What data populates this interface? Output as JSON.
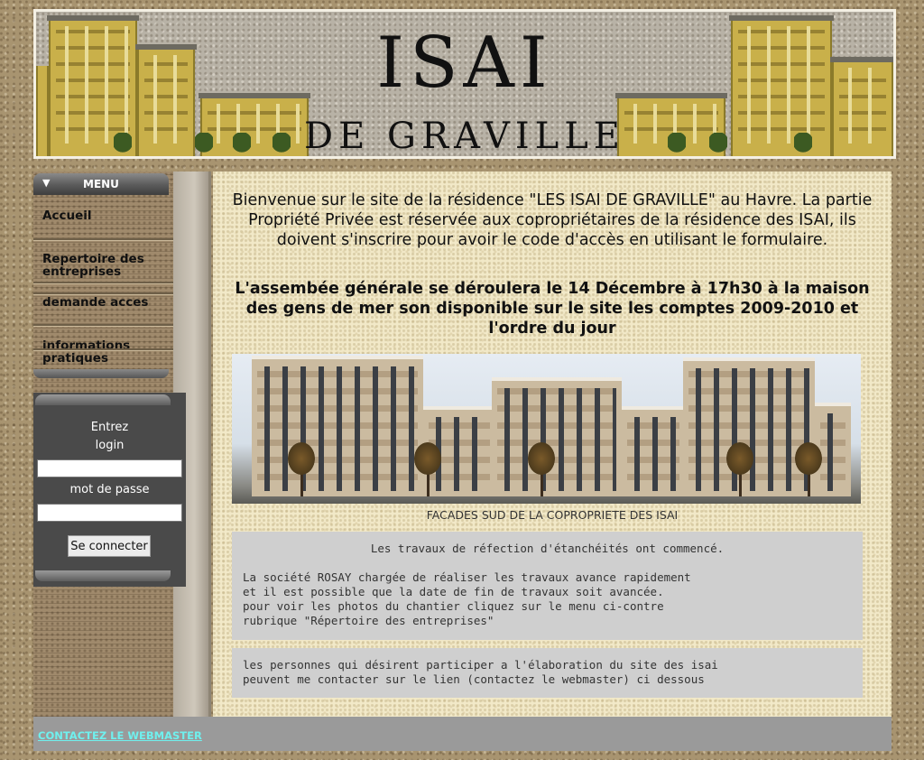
{
  "banner": {
    "title": "ISAI",
    "subtitle": "DE GRAVILLE"
  },
  "menu": {
    "heading": "MENU",
    "items": [
      {
        "label": "Accueil"
      },
      {
        "label": "Repertoire des entreprises"
      },
      {
        "label": "demande acces"
      },
      {
        "label": "informations pratiques"
      }
    ]
  },
  "login": {
    "intro": "Entrez",
    "login_label": "login",
    "password_label": "mot de passe",
    "submit_label": "Se connecter"
  },
  "main": {
    "welcome": "Bienvenue sur le site de la résidence \"LES ISAI DE GRAVILLE\" au Havre. La partie Propriété Privée est réservée aux copropriétaires de la résidence des ISAI, ils doivent s'inscrire pour avoir le code d'accès en utilisant le formulaire.",
    "announcement": "L'assembée générale se déroulera le 14 Décembre à 17h30 à la maison des gens de mer son disponible sur le site les comptes 2009-2010 et l'ordre du jour",
    "photo_caption": "FACADES SUD DE LA COPROPRIETE DES ISAI",
    "notice1": {
      "title": "Les travaux de réfection d'étanchéités ont commencé.",
      "lines": [
        "La société ROSAY chargée de réaliser les travaux avance rapidement",
        "et il est possible que la date de fin de travaux soit avancée.",
        "pour voir les photos du chantier cliquez sur le menu ci-contre",
        "rubrique \"Répertoire des entreprises\""
      ]
    },
    "notice2": {
      "lines": [
        "les personnes qui désirent participer a l'élaboration du site des isai",
        "peuvent me contacter sur le lien (contactez le webmaster) ci dessous"
      ]
    }
  },
  "footer": {
    "contact_label": "CONTACTEZ LE WEBMASTER"
  }
}
